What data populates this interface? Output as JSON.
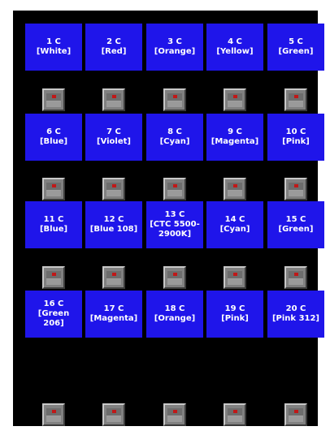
{
  "channels": [
    {
      "number": "1 C",
      "name": "[White]"
    },
    {
      "number": "2 C",
      "name": "[Red]"
    },
    {
      "number": "3 C",
      "name": "[Orange]"
    },
    {
      "number": "4 C",
      "name": "[Yellow]"
    },
    {
      "number": "5 C",
      "name": "[Green]"
    },
    {
      "number": "6 C",
      "name": "[Blue]"
    },
    {
      "number": "7 C",
      "name": "[Violet]"
    },
    {
      "number": "8 C",
      "name": "[Cyan]"
    },
    {
      "number": "9 C",
      "name": "[Magenta]"
    },
    {
      "number": "10 C",
      "name": "[Pink]"
    },
    {
      "number": "11 C",
      "name": "[Blue]"
    },
    {
      "number": "12 C",
      "name": "[Blue 108]"
    },
    {
      "number": "13 C",
      "name": "[CTC 5500-2900K]"
    },
    {
      "number": "14 C",
      "name": "[Cyan]"
    },
    {
      "number": "15 C",
      "name": "[Green]"
    },
    {
      "number": "16 C",
      "name": "[Green 206]"
    },
    {
      "number": "17 C",
      "name": "[Magenta]"
    },
    {
      "number": "18 C",
      "name": "[Orange]"
    },
    {
      "number": "19 C",
      "name": "[Pink]"
    },
    {
      "number": "20 C",
      "name": "[Pink 312]"
    }
  ],
  "colors": {
    "button_blue": "#1f15ea",
    "background": "#000000",
    "icon_gray": "#808080",
    "icon_red_dot": "#c01818"
  },
  "icon": "color-swatch-icon"
}
